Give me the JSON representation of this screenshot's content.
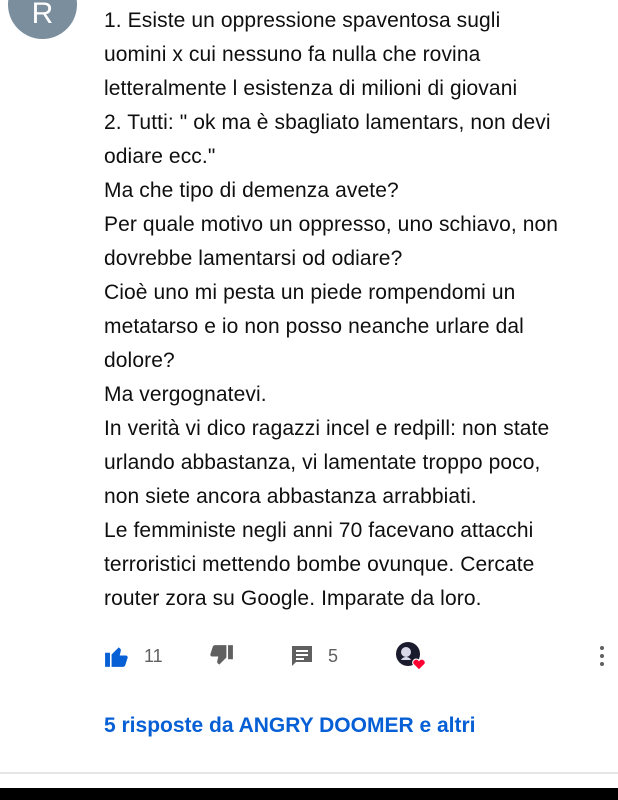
{
  "comment": {
    "avatar_letter": "R",
    "avatar_color": "#7a8e9e",
    "lines": [
      "1. Esiste un oppressione spaventosa sugli",
      "uomini x cui nessuno fa nulla che rovina",
      "letteralmente l esistenza di milioni di giovani",
      "2. Tutti: \" ok ma è sbagliato lamentars, non devi",
      "odiare ecc.\"",
      "Ma che tipo di demenza avete?",
      "Per quale motivo un oppresso, uno schiavo, non",
      "dovrebbe lamentarsi od odiare?",
      "Cioè uno mi pesta un piede rompendomi un",
      "metatarso e io non posso neanche urlare dal",
      "dolore?",
      "Ma vergognatevi.",
      "In verità vi dico ragazzi incel e redpill: non state",
      "urlando abbastanza, vi lamentate troppo poco,",
      "non siete ancora abbastanza arrabbiati.",
      "Le femministe negli anni 70 facevano attacchi",
      "terroristici mettendo bombe ovunque. Cercate",
      "router zora su Google. Imparate da loro."
    ]
  },
  "actions": {
    "like_count": "11",
    "reply_count": "5",
    "like_icon": "thumbs-up-icon",
    "dislike_icon": "thumbs-down-icon",
    "reply_icon": "comment-icon",
    "heart_icon": "creator-heart-icon",
    "more_icon": "more-vertical-icon",
    "like_color": "#065fd4",
    "heart_color": "#ff0033"
  },
  "replies": {
    "label": "5 risposte da ANGRY DOOMER e altri",
    "color": "#065fd4"
  }
}
